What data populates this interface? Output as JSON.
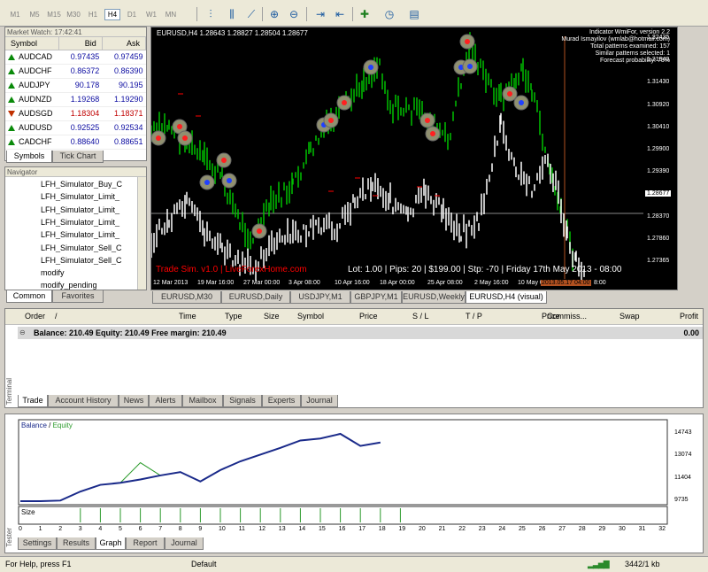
{
  "toolbar": {
    "timeframes": [
      "M1",
      "M5",
      "M15",
      "M30",
      "H1",
      "H4",
      "D1",
      "W1",
      "MN"
    ],
    "active": "H4"
  },
  "market_watch": {
    "title": "Market Watch: 17:42:41",
    "headers": [
      "Symbol",
      "Bid",
      "Ask"
    ],
    "rows": [
      {
        "symbol": "AUDCAD",
        "bid": "0.97435",
        "ask": "0.97459",
        "dir": "up"
      },
      {
        "symbol": "AUDCHF",
        "bid": "0.86372",
        "ask": "0.86390",
        "dir": "up"
      },
      {
        "symbol": "AUDJPY",
        "bid": "90.178",
        "ask": "90.195",
        "dir": "up"
      },
      {
        "symbol": "AUDNZD",
        "bid": "1.19268",
        "ask": "1.19290",
        "dir": "up"
      },
      {
        "symbol": "AUDSGD",
        "bid": "1.18304",
        "ask": "1.18371",
        "dir": "down"
      },
      {
        "symbol": "AUDUSD",
        "bid": "0.92525",
        "ask": "0.92534",
        "dir": "up"
      },
      {
        "symbol": "CADCHF",
        "bid": "0.88640",
        "ask": "0.88651",
        "dir": "up"
      }
    ],
    "tabs": [
      "Symbols",
      "Tick Chart"
    ]
  },
  "navigator": {
    "title": "Navigator",
    "items": [
      "LFH_Simulator_Buy_C",
      "LFH_Simulator_Limit_",
      "LFH_Simulator_Limit_",
      "LFH_Simulator_Limit_",
      "LFH_Simulator_Limit_",
      "LFH_Simulator_Sell_C",
      "LFH_Simulator_Sell_C",
      "modify",
      "modify_pending"
    ],
    "tabs": [
      "Common",
      "Favorites"
    ]
  },
  "chart": {
    "header": "EURUSD,H4  1.28643 1.28827 1.28504 1.28677",
    "indicator_lines": [
      "Indicator WmiFor, version 2.2",
      "Murad Ismayilov (wmlab@hotmail.com)",
      "Total patterns examined: 157",
      "Similar patterns selected: 1",
      "Forecast probability: 73%"
    ],
    "prices": [
      "1.32435",
      "1.31940",
      "1.31430",
      "1.30920",
      "1.30410",
      "1.29900",
      "1.29390",
      "1.28677",
      "1.28370",
      "1.27860",
      "1.27365"
    ],
    "current_price": "1.28677",
    "dates": [
      "12 Mar 2013",
      "19 Mar 16:00",
      "27 Mar 00:00",
      "3 Apr 08:00",
      "10 Apr 16:00",
      "18 Apr 00:00",
      "25 Apr 08:00",
      "2 May 16:00",
      "10 May 00:00",
      "2013.05.17 04:00",
      "8:00"
    ],
    "trade_sim": "Trade Sim. v1.0  |  LiveForexHome.com",
    "trade_info": "Lot: 1.00  |  Pips: 20  |  $199.00  |  Stp: -70  |  Friday 17th May 2013 - 08:00",
    "tabs": [
      "EURUSD,M30",
      "EURUSD,Daily",
      "USDJPY,M1",
      "GBPJPY,M1",
      "EURUSD,Weekly",
      "EURUSD,H4 (visual)"
    ],
    "colors": {
      "bull": "#00c000",
      "bear": "#ffffff",
      "accent": "#ff0000"
    }
  },
  "terminal": {
    "headers": [
      "Order",
      "/",
      "Time",
      "Type",
      "Size",
      "Symbol",
      "Price",
      "S / L",
      "T / P",
      "Price",
      "Commiss...",
      "Swap",
      "Profit"
    ],
    "balance_text": "Balance: 210.49  Equity: 210.49  Free margin: 210.49",
    "profit": "0.00",
    "tabs": [
      "Trade",
      "Account History",
      "News",
      "Alerts",
      "Mailbox",
      "Signals",
      "Experts",
      "Journal"
    ],
    "side_label": "Terminal"
  },
  "tester": {
    "legend_balance": "Balance",
    "legend_sep": " / ",
    "legend_equity": "Equity",
    "y_labels": [
      "14743",
      "13074",
      "11404",
      "9735"
    ],
    "size_label": "Size",
    "x_labels": [
      "0",
      "1",
      "2",
      "3",
      "4",
      "5",
      "6",
      "7",
      "8",
      "9",
      "10",
      "11",
      "12",
      "13",
      "14",
      "15",
      "16",
      "17",
      "18",
      "19",
      "20",
      "21",
      "22",
      "23",
      "24",
      "25",
      "26",
      "27",
      "28",
      "29",
      "30",
      "31",
      "32"
    ],
    "tabs": [
      "Settings",
      "Results",
      "Graph",
      "Report",
      "Journal"
    ],
    "side_label": "Tester",
    "balance": [
      9735,
      9735,
      9780,
      10450,
      10950,
      11100,
      11350,
      11650,
      11900,
      11200,
      12050,
      12700,
      13200,
      13700,
      14250,
      14400,
      14743,
      13850,
      14100
    ],
    "equity": [
      9735,
      9735,
      9780,
      10450,
      10950,
      11100,
      12600,
      11650,
      11900,
      11200,
      12050,
      12700,
      13200,
      13700,
      14250,
      14400,
      14743,
      13850,
      14100
    ]
  },
  "status": {
    "help": "For Help, press F1",
    "profile": "Default",
    "traffic": "3442/1 kb"
  }
}
